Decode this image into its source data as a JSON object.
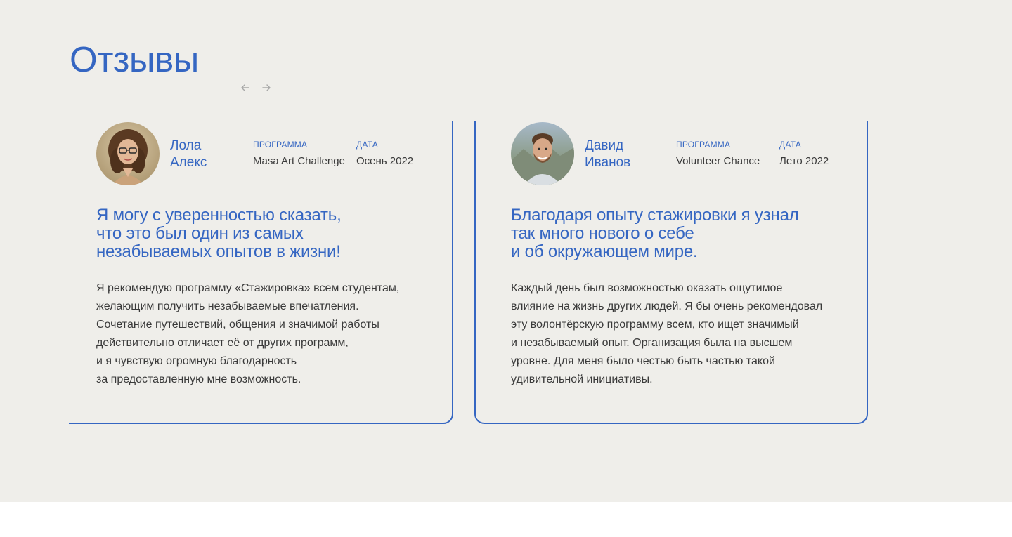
{
  "section": {
    "title": "Отзывы",
    "prev_icon": "arrow-left-icon",
    "next_icon": "arrow-right-icon"
  },
  "labels": {
    "program": "ПРОГРАММА",
    "date": "ДАТА"
  },
  "reviews": [
    {
      "name_first": "Лола",
      "name_last": "Алекс",
      "program": "Masa Art Challenge",
      "date": "Осень 2022",
      "quote_lines": [
        "Я могу с уверенностью сказать,",
        "что это был один из самых",
        "незабываемых опытов в жизни!"
      ],
      "body_lines": [
        "Я рекомендую программу «Стажировка» всем студентам,",
        "желающим получить незабываемые впечатления.",
        "Сочетание путешествий, общения и значимой работы",
        "действительно отличает её от других программ,",
        "и я чувствую огромную благодарность",
        "за предоставленную мне возможность."
      ]
    },
    {
      "name_first": "Давид",
      "name_last": "Иванов",
      "program": "Volunteer Chance",
      "date": "Лето 2022",
      "quote_lines": [
        "Благодаря опыту стажировки я узнал",
        "так много нового о себе",
        "и об окружающем мире."
      ],
      "body_lines": [
        "Каждый день был возможностью оказать ощутимое",
        "влияние на жизнь других людей. Я бы очень рекомендовал",
        "эту волонтёрскую программу всем, кто ищет значимый",
        "и незабываемый опыт. Организация была на высшем",
        "уровне. Для меня было честью быть частью такой",
        "удивительной инициативы."
      ]
    }
  ],
  "colors": {
    "accent": "#3566c2",
    "background": "#efeeea",
    "text": "#3a3a3a"
  }
}
